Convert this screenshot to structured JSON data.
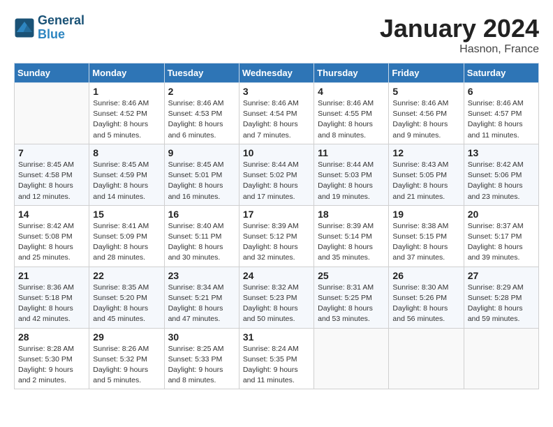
{
  "header": {
    "logo_line1": "General",
    "logo_line2": "Blue",
    "title": "January 2024",
    "subtitle": "Hasnon, France"
  },
  "columns": [
    "Sunday",
    "Monday",
    "Tuesday",
    "Wednesday",
    "Thursday",
    "Friday",
    "Saturday"
  ],
  "weeks": [
    [
      {
        "day": "",
        "info": ""
      },
      {
        "day": "1",
        "info": "Sunrise: 8:46 AM\nSunset: 4:52 PM\nDaylight: 8 hours\nand 5 minutes."
      },
      {
        "day": "2",
        "info": "Sunrise: 8:46 AM\nSunset: 4:53 PM\nDaylight: 8 hours\nand 6 minutes."
      },
      {
        "day": "3",
        "info": "Sunrise: 8:46 AM\nSunset: 4:54 PM\nDaylight: 8 hours\nand 7 minutes."
      },
      {
        "day": "4",
        "info": "Sunrise: 8:46 AM\nSunset: 4:55 PM\nDaylight: 8 hours\nand 8 minutes."
      },
      {
        "day": "5",
        "info": "Sunrise: 8:46 AM\nSunset: 4:56 PM\nDaylight: 8 hours\nand 9 minutes."
      },
      {
        "day": "6",
        "info": "Sunrise: 8:46 AM\nSunset: 4:57 PM\nDaylight: 8 hours\nand 11 minutes."
      }
    ],
    [
      {
        "day": "7",
        "info": "Sunrise: 8:45 AM\nSunset: 4:58 PM\nDaylight: 8 hours\nand 12 minutes."
      },
      {
        "day": "8",
        "info": "Sunrise: 8:45 AM\nSunset: 4:59 PM\nDaylight: 8 hours\nand 14 minutes."
      },
      {
        "day": "9",
        "info": "Sunrise: 8:45 AM\nSunset: 5:01 PM\nDaylight: 8 hours\nand 16 minutes."
      },
      {
        "day": "10",
        "info": "Sunrise: 8:44 AM\nSunset: 5:02 PM\nDaylight: 8 hours\nand 17 minutes."
      },
      {
        "day": "11",
        "info": "Sunrise: 8:44 AM\nSunset: 5:03 PM\nDaylight: 8 hours\nand 19 minutes."
      },
      {
        "day": "12",
        "info": "Sunrise: 8:43 AM\nSunset: 5:05 PM\nDaylight: 8 hours\nand 21 minutes."
      },
      {
        "day": "13",
        "info": "Sunrise: 8:42 AM\nSunset: 5:06 PM\nDaylight: 8 hours\nand 23 minutes."
      }
    ],
    [
      {
        "day": "14",
        "info": "Sunrise: 8:42 AM\nSunset: 5:08 PM\nDaylight: 8 hours\nand 25 minutes."
      },
      {
        "day": "15",
        "info": "Sunrise: 8:41 AM\nSunset: 5:09 PM\nDaylight: 8 hours\nand 28 minutes."
      },
      {
        "day": "16",
        "info": "Sunrise: 8:40 AM\nSunset: 5:11 PM\nDaylight: 8 hours\nand 30 minutes."
      },
      {
        "day": "17",
        "info": "Sunrise: 8:39 AM\nSunset: 5:12 PM\nDaylight: 8 hours\nand 32 minutes."
      },
      {
        "day": "18",
        "info": "Sunrise: 8:39 AM\nSunset: 5:14 PM\nDaylight: 8 hours\nand 35 minutes."
      },
      {
        "day": "19",
        "info": "Sunrise: 8:38 AM\nSunset: 5:15 PM\nDaylight: 8 hours\nand 37 minutes."
      },
      {
        "day": "20",
        "info": "Sunrise: 8:37 AM\nSunset: 5:17 PM\nDaylight: 8 hours\nand 39 minutes."
      }
    ],
    [
      {
        "day": "21",
        "info": "Sunrise: 8:36 AM\nSunset: 5:18 PM\nDaylight: 8 hours\nand 42 minutes."
      },
      {
        "day": "22",
        "info": "Sunrise: 8:35 AM\nSunset: 5:20 PM\nDaylight: 8 hours\nand 45 minutes."
      },
      {
        "day": "23",
        "info": "Sunrise: 8:34 AM\nSunset: 5:21 PM\nDaylight: 8 hours\nand 47 minutes."
      },
      {
        "day": "24",
        "info": "Sunrise: 8:32 AM\nSunset: 5:23 PM\nDaylight: 8 hours\nand 50 minutes."
      },
      {
        "day": "25",
        "info": "Sunrise: 8:31 AM\nSunset: 5:25 PM\nDaylight: 8 hours\nand 53 minutes."
      },
      {
        "day": "26",
        "info": "Sunrise: 8:30 AM\nSunset: 5:26 PM\nDaylight: 8 hours\nand 56 minutes."
      },
      {
        "day": "27",
        "info": "Sunrise: 8:29 AM\nSunset: 5:28 PM\nDaylight: 8 hours\nand 59 minutes."
      }
    ],
    [
      {
        "day": "28",
        "info": "Sunrise: 8:28 AM\nSunset: 5:30 PM\nDaylight: 9 hours\nand 2 minutes."
      },
      {
        "day": "29",
        "info": "Sunrise: 8:26 AM\nSunset: 5:32 PM\nDaylight: 9 hours\nand 5 minutes."
      },
      {
        "day": "30",
        "info": "Sunrise: 8:25 AM\nSunset: 5:33 PM\nDaylight: 9 hours\nand 8 minutes."
      },
      {
        "day": "31",
        "info": "Sunrise: 8:24 AM\nSunset: 5:35 PM\nDaylight: 9 hours\nand 11 minutes."
      },
      {
        "day": "",
        "info": ""
      },
      {
        "day": "",
        "info": ""
      },
      {
        "day": "",
        "info": ""
      }
    ]
  ]
}
